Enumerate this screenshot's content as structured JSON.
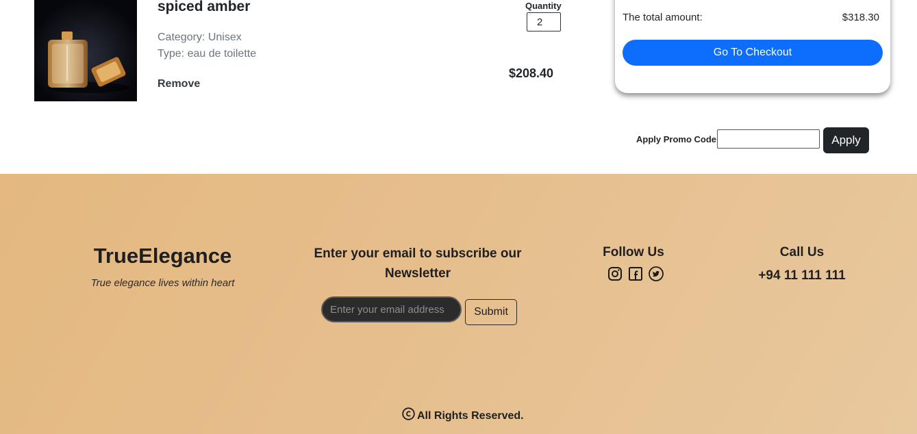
{
  "cart_item": {
    "title": "spiced amber",
    "category": "Category: Unisex",
    "type": "Type: eau de toilette",
    "remove_label": "Remove",
    "quantity_label": "Quantity",
    "quantity_value": "2",
    "price": "$208.40",
    "image_icon": "perfume-bottle-image"
  },
  "summary": {
    "total_label": "The total amount:",
    "total_value": "$318.30",
    "checkout_label": "Go To Checkout",
    "accent": "#0d6efd"
  },
  "promo": {
    "label": "Apply Promo Code",
    "input_value": "",
    "apply_label": "Apply"
  },
  "footer": {
    "brand": "TrueElegance",
    "tagline": "True elegance lives within heart",
    "newsletter_heading": "Enter your email to subscribe our Newsletter",
    "email_placeholder": "Enter your email address",
    "submit_label": "Submit",
    "follow_heading": "Follow Us",
    "social_icons": [
      "instagram-icon",
      "facebook-icon",
      "twitter-icon"
    ],
    "call_heading": "Call Us",
    "phone": "+94 11 111 111",
    "copyright": "All Rights Reserved.",
    "background": "#e6bf8e"
  }
}
